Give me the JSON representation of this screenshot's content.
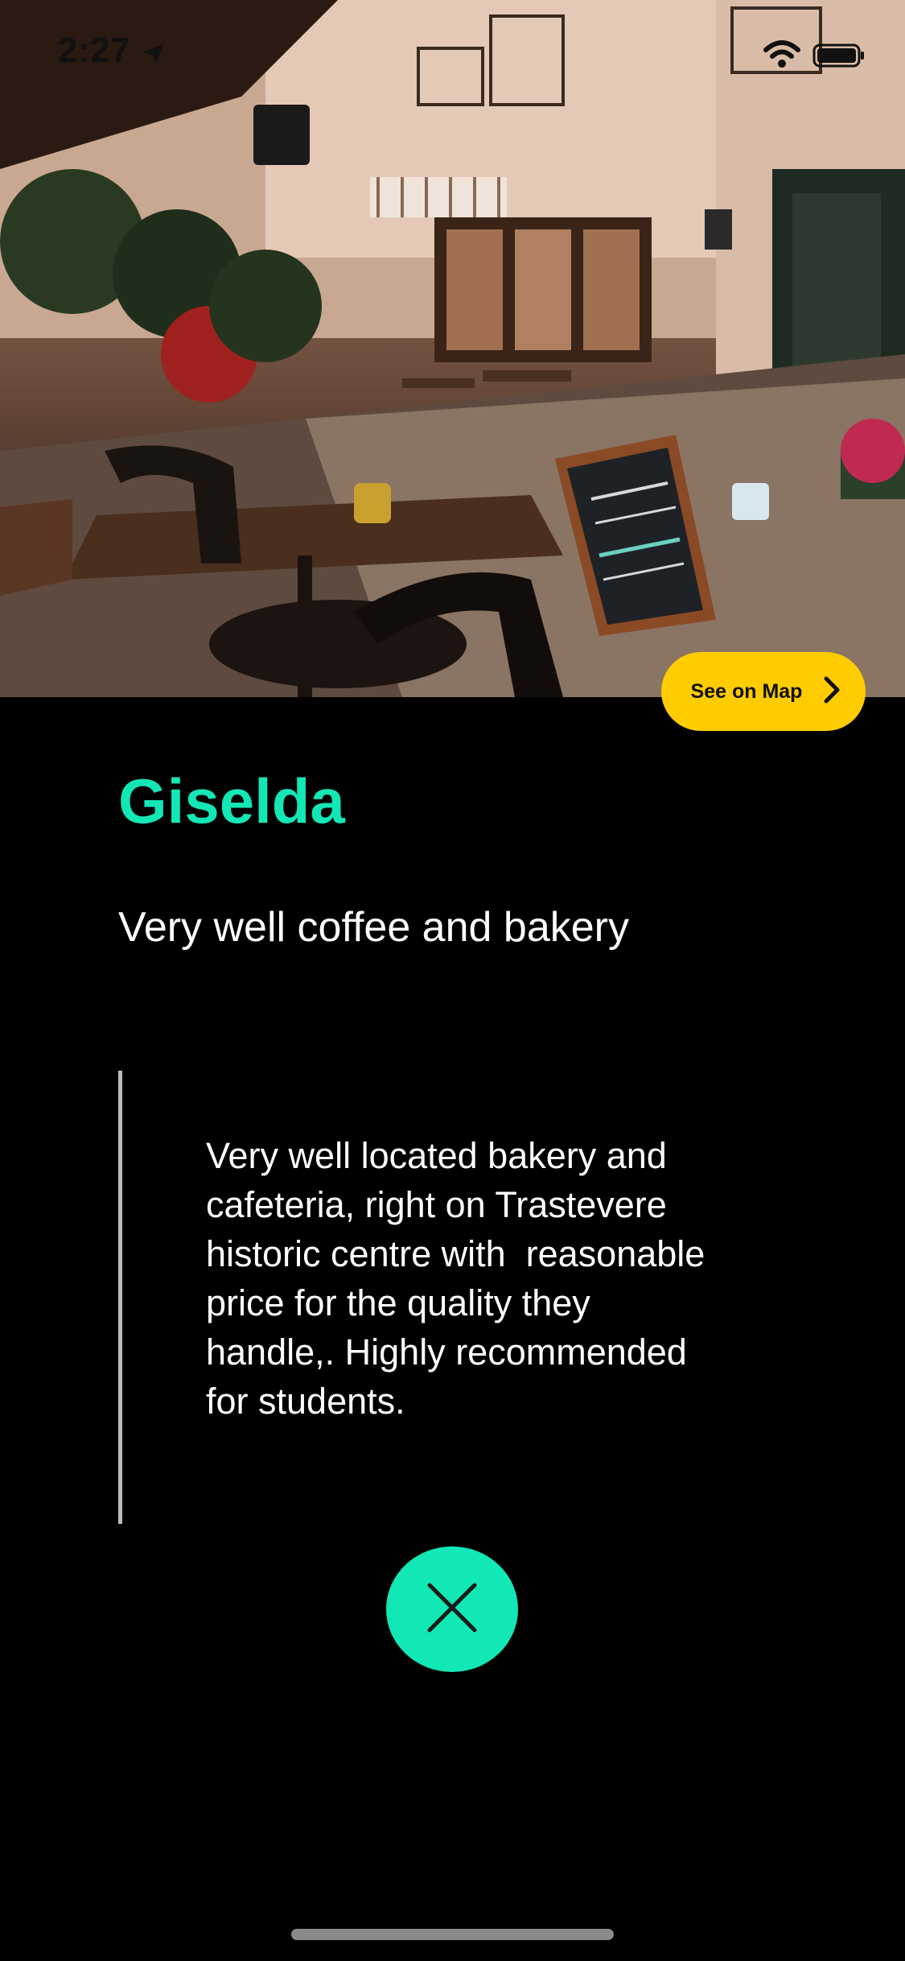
{
  "status_bar": {
    "time": "2:27"
  },
  "hero": {
    "image_description_icon": "cafe-street-photo"
  },
  "map_button": {
    "label": "See on Map",
    "icon": "chevron-right-icon",
    "color": "#ffcc00"
  },
  "place": {
    "name": "Giselda",
    "tagline": "Very well coffee and bakery",
    "review": "Very well located bakery and\ncafeteria, right on Trastevere\nhistoric centre with  reasonable\nprice for the quality they\nhandle,. Highly recommended\nfor students."
  },
  "close_button": {
    "icon": "close-icon",
    "color": "#12e7b6"
  },
  "colors": {
    "accent": "#12e7b6",
    "background": "#000000",
    "map_button": "#ffcc00"
  }
}
